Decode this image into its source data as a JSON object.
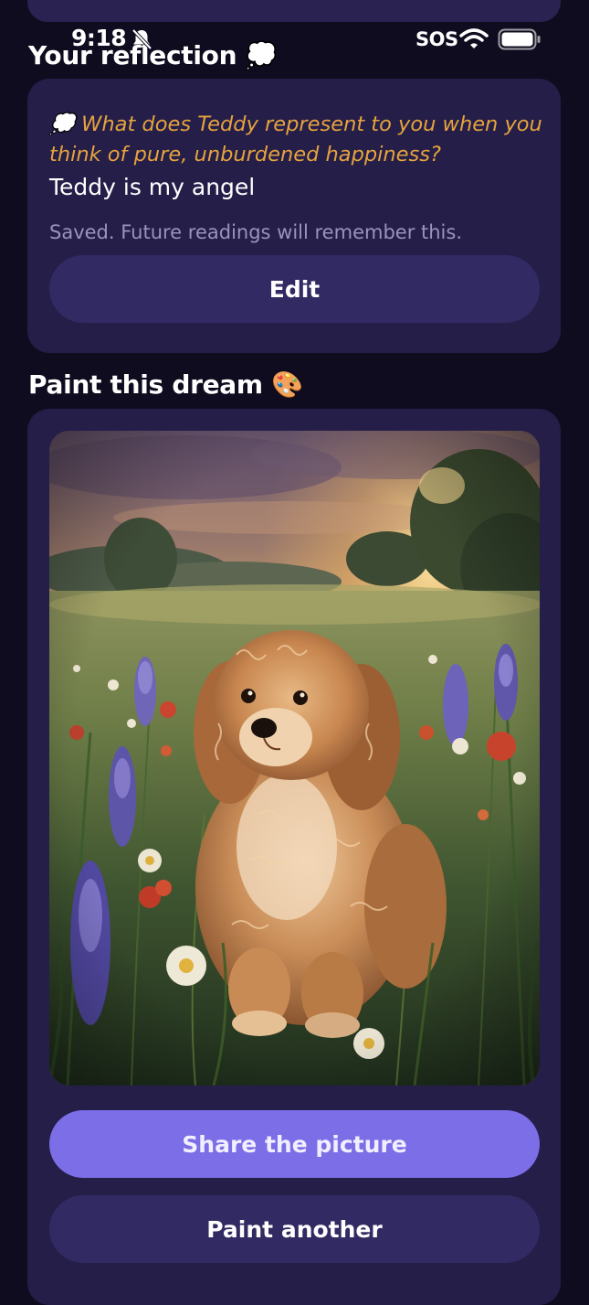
{
  "status_bar": {
    "time": "9:18",
    "carrier": "SOS",
    "icons": [
      "bell-slash-icon",
      "wifi-icon",
      "battery-icon"
    ]
  },
  "reflection": {
    "title": "Your reflection 💭",
    "prompt": "💭 What does Teddy represent to you when you think of pure, unburdened happiness?",
    "answer": "Teddy is my angel",
    "saved_note": "Saved. Future readings will remember this.",
    "edit_label": "Edit"
  },
  "paint": {
    "title": "Paint this dream 🎨",
    "image_alt": "Oil painting of a curly golden dog sitting in a wildflower meadow at sunset",
    "share_label": "Share the picture",
    "paint_another_label": "Paint another"
  },
  "colors": {
    "background": "#0f0c1f",
    "card": "#241e48",
    "secondary_button": "#322a62",
    "primary_button": "#7b6ee6",
    "prompt_text": "#e6a33e",
    "muted_text": "#9b93bd"
  }
}
